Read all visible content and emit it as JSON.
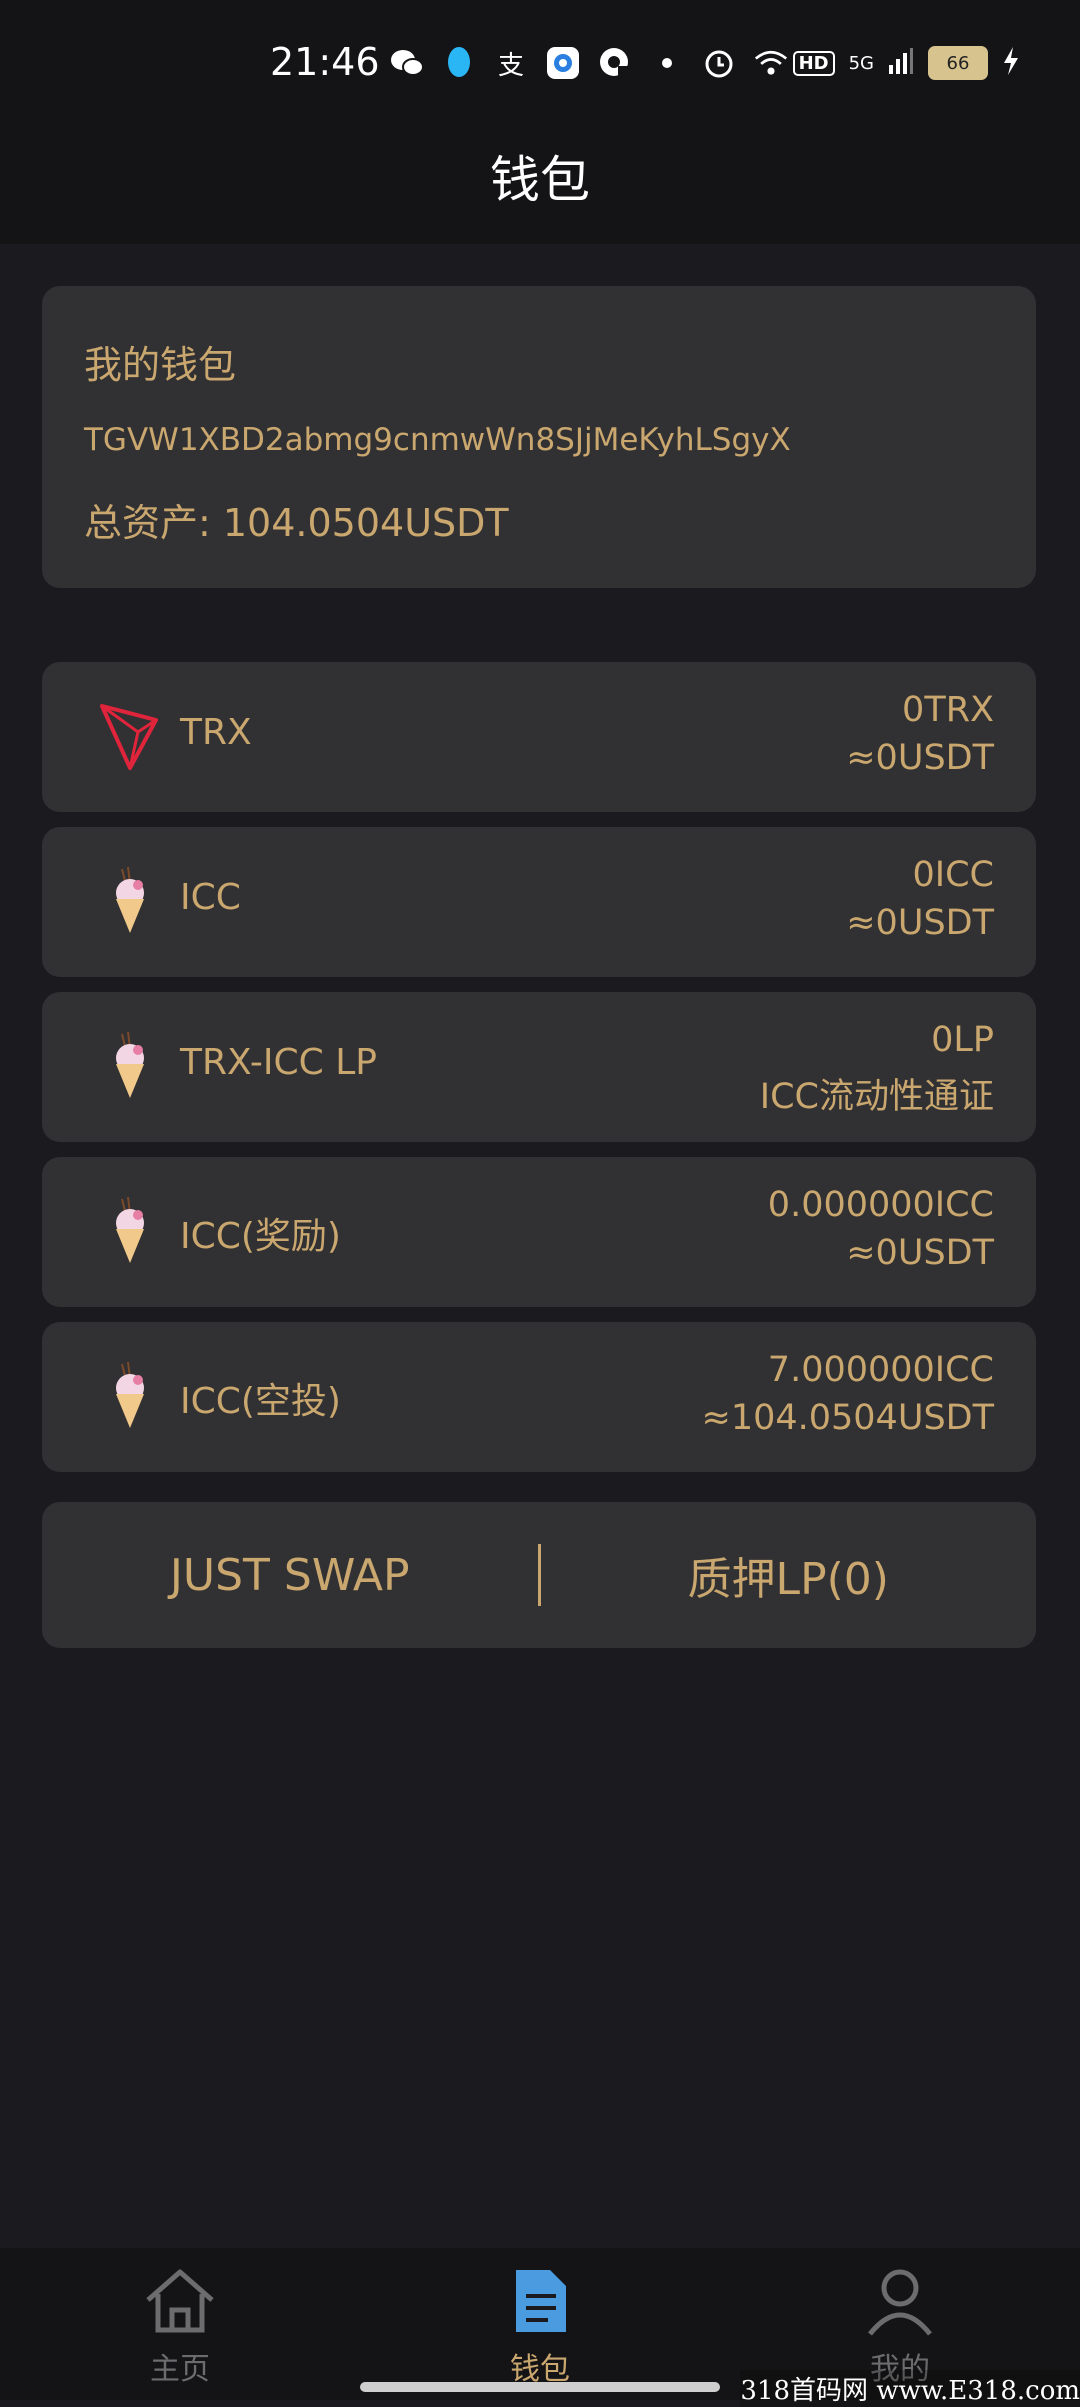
{
  "status_bar": {
    "time": "21:46",
    "hd": "HD",
    "network": "5G",
    "battery": "66",
    "icons": [
      "wechat-icon",
      "qq-icon",
      "alipay-icon",
      "browser-icon",
      "quark-icon",
      "dot-icon",
      "alarm-icon",
      "wifi-icon"
    ]
  },
  "header": {
    "title": "钱包"
  },
  "wallet": {
    "title": "我的钱包",
    "address": "TGVW1XBD2abmg9cnmwWn8SJjMeKyhLSgyX",
    "total": "总资产: 104.0504USDT"
  },
  "assets": [
    {
      "icon": "tron-icon",
      "name": "TRX",
      "amount": "0TRX",
      "sub": "≈0USDT"
    },
    {
      "icon": "icecream-icon",
      "name": "ICC",
      "amount": "0ICC",
      "sub": "≈0USDT"
    },
    {
      "icon": "icecream-icon",
      "name": "TRX-ICC LP",
      "amount": "0LP",
      "sub": "ICC流动性通证"
    },
    {
      "icon": "icecream-icon",
      "name": "ICC(奖励)",
      "amount": "0.000000ICC",
      "sub": "≈0USDT"
    },
    {
      "icon": "icecream-icon",
      "name": "ICC(空投)",
      "amount": "7.000000ICC",
      "sub": "≈104.0504USDT"
    }
  ],
  "actions": {
    "swap": "JUST SWAP",
    "stake": "质押LP(0)"
  },
  "tabs": [
    {
      "icon": "home-icon",
      "label": "主页"
    },
    {
      "icon": "wallet-doc-icon",
      "label": "钱包"
    },
    {
      "icon": "user-icon",
      "label": "我的"
    }
  ],
  "watermark": "318首码网 www.E318.com",
  "colors": {
    "accent": "#c9a76f",
    "background": "#1b1b1f",
    "card": "#313133",
    "tab_active_icon": "#4b9be0"
  }
}
